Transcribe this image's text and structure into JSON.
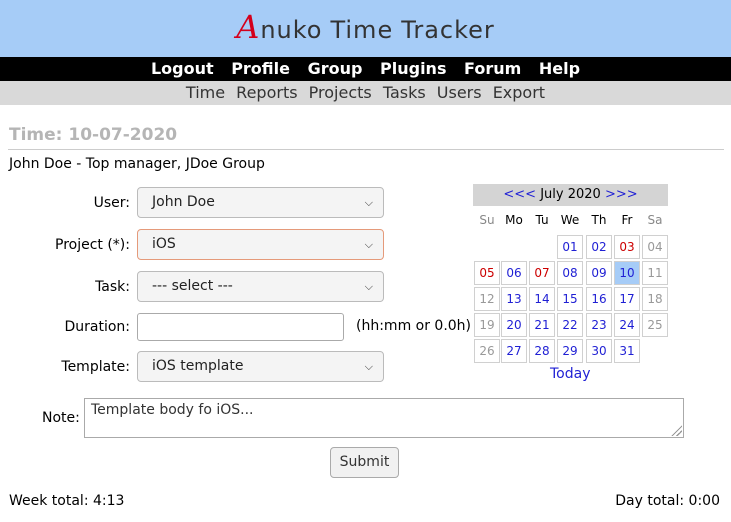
{
  "brand": {
    "first_letter": "A",
    "rest": "nuko",
    "word2": "Time",
    "word3": "Tracker"
  },
  "topnav": [
    "Logout",
    "Profile",
    "Group",
    "Plugins",
    "Forum",
    "Help"
  ],
  "subnav": [
    "Time",
    "Reports",
    "Projects",
    "Tasks",
    "Users",
    "Export"
  ],
  "page_title": "Time: 10-07-2020",
  "user_info": "John Doe - Top manager, JDoe Group",
  "form": {
    "user_label": "User:",
    "user_value": "John Doe",
    "project_label": "Project (*):",
    "project_value": "iOS",
    "task_label": "Task:",
    "task_value": "--- select ---",
    "duration_label": "Duration:",
    "duration_value": "",
    "duration_hint": "(hh:mm or 0.0h)",
    "template_label": "Template:",
    "template_value": "iOS template",
    "note_label": "Note:",
    "note_value": "Template body fo iOS...",
    "submit_label": "Submit"
  },
  "calendar": {
    "prev": "<<<",
    "month": "July 2020",
    "next": ">>>",
    "weekdays": [
      "Su",
      "Mo",
      "Tu",
      "We",
      "Th",
      "Fr",
      "Sa"
    ],
    "days": [
      "01",
      "02",
      "03",
      "04",
      "05",
      "06",
      "07",
      "08",
      "09",
      "10",
      "11",
      "12",
      "13",
      "14",
      "15",
      "16",
      "17",
      "18",
      "19",
      "20",
      "21",
      "22",
      "23",
      "24",
      "25",
      "26",
      "27",
      "28",
      "29",
      "30",
      "31"
    ],
    "holidays": [
      "03",
      "05",
      "07"
    ],
    "selected": "10",
    "today_label": "Today"
  },
  "totals": {
    "week": "Week total: 4:13",
    "day": "Day total: 0:00"
  },
  "colors": {
    "header_bg": "#a6ccf7",
    "link": "#1f1fd4",
    "holiday": "#cc0000",
    "logo_accent": "#d4001c"
  }
}
